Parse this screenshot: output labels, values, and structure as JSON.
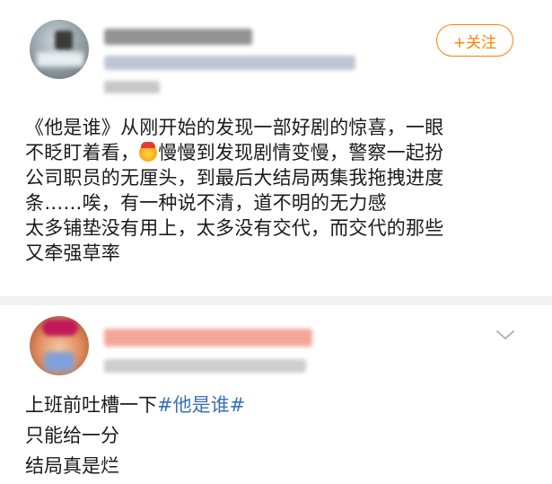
{
  "post": {
    "follow_label": "+关注",
    "body": {
      "line1": "《他是谁》从刚开始的发现一部好剧的惊喜，一眼",
      "line2_before": "不眨盯着看，",
      "line2_emoji": "moustache-face-emoji",
      "line2_after": "慢慢到发现剧情变慢，警察一起扮",
      "line3": "公司职员的无厘头，到最后大结局两集我拖拽进度",
      "line4": "条……唉，有一种说不清，道不明的无力感",
      "line5": "太多铺垫没有用上，太多没有交代，而交代的那些",
      "line6": "又牵强草率"
    }
  },
  "comment": {
    "line1_prefix": "上班前吐槽一下",
    "line1_hashtag": "#他是谁#",
    "line2": "只能给一分",
    "line3": "结局真是烂"
  },
  "colors": {
    "accent": "#ff8200",
    "link": "#3b6fb6"
  },
  "icons": {
    "expand": "chevron-down-icon"
  }
}
